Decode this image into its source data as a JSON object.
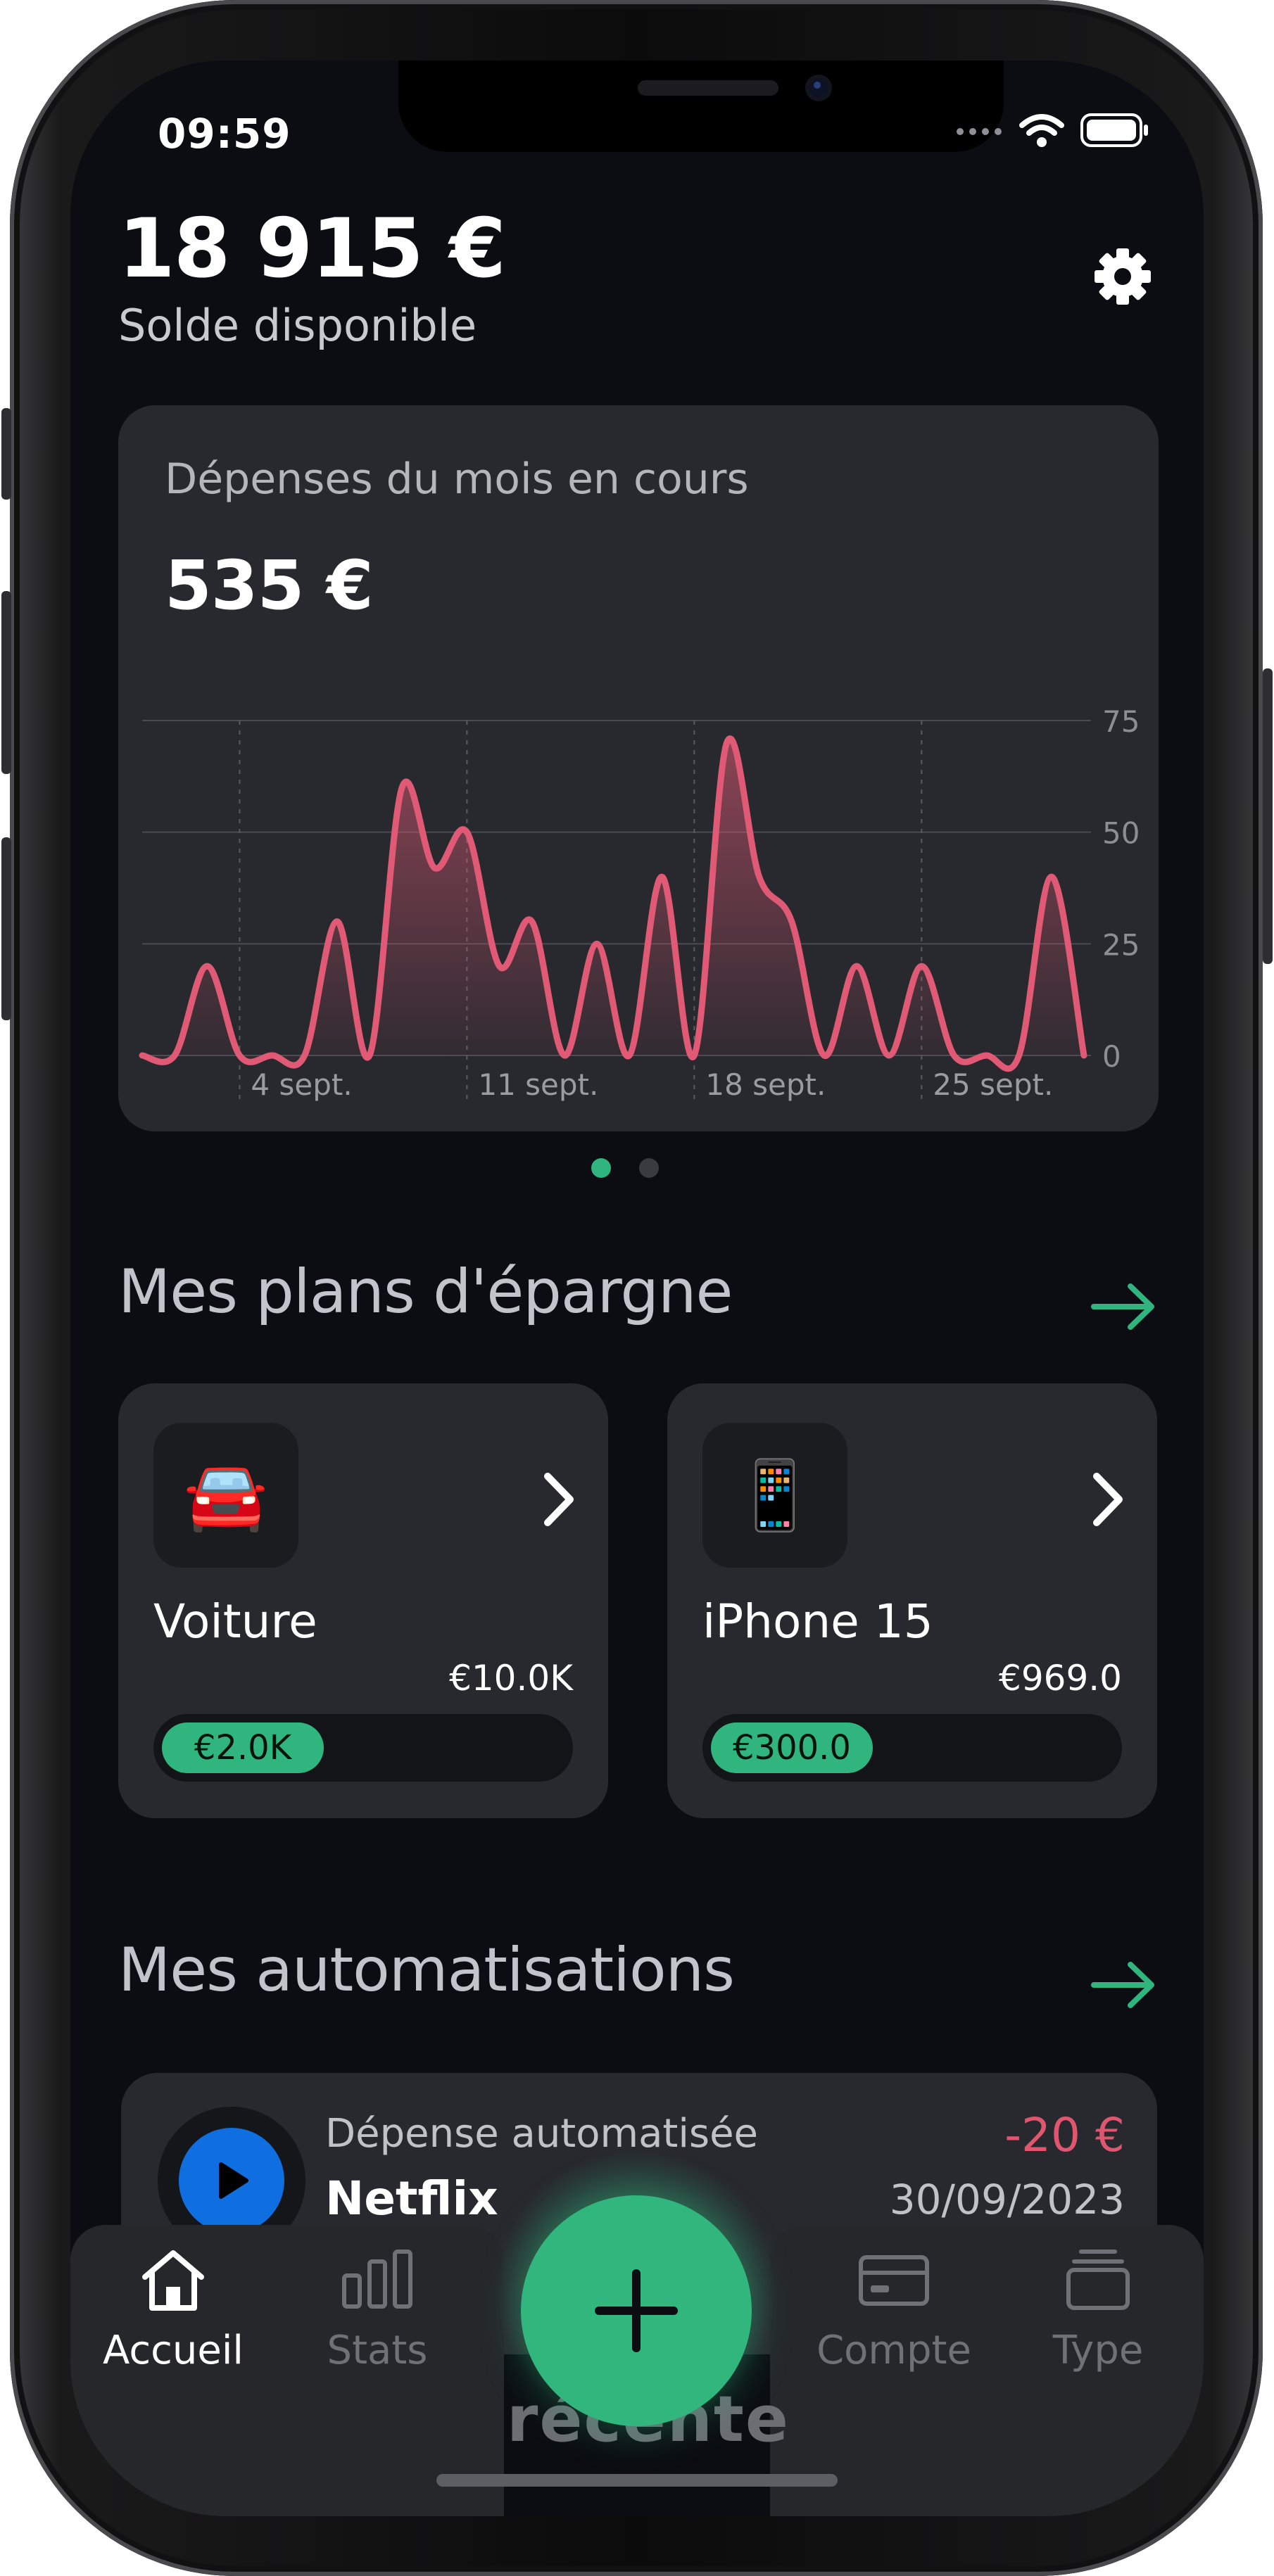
{
  "status_bar": {
    "time": "09:59"
  },
  "header": {
    "balance": "18 915 €",
    "balance_label": "Solde disponible"
  },
  "spending_card": {
    "title": "Dépenses du mois en cours",
    "total": "535 €"
  },
  "chart_data": {
    "type": "area",
    "x": [
      "1 sept.",
      "2 sept.",
      "3 sept.",
      "4 sept.",
      "5 sept.",
      "6 sept.",
      "7 sept.",
      "8 sept.",
      "9 sept.",
      "10 sept.",
      "11 sept.",
      "12 sept.",
      "13 sept.",
      "14 sept.",
      "15 sept.",
      "16 sept.",
      "17 sept.",
      "18 sept.",
      "19 sept.",
      "20 sept.",
      "21 sept.",
      "22 sept.",
      "23 sept.",
      "24 sept.",
      "25 sept.",
      "26 sept.",
      "27 sept.",
      "28 sept.",
      "29 sept.",
      "30 sept."
    ],
    "values": [
      0,
      0,
      20,
      0,
      0,
      0,
      30,
      0,
      60,
      42,
      50,
      20,
      30,
      0,
      25,
      0,
      40,
      0,
      70,
      40,
      30,
      0,
      20,
      0,
      20,
      0,
      0,
      0,
      40,
      0
    ],
    "xticks": [
      "4 sept.",
      "11 sept.",
      "18 sept.",
      "25 sept."
    ],
    "yticks": [
      0,
      25,
      50,
      75
    ],
    "ylim": [
      0,
      75
    ],
    "grid": true,
    "color": "#e05a76"
  },
  "pager": {
    "count": 2,
    "active": 0
  },
  "savings": {
    "title": "Mes plans d'épargne",
    "plans": [
      {
        "emoji": "🚘",
        "name": "Voiture",
        "target": "€10.0K",
        "saved": "€2.0K",
        "progress": 0.2
      },
      {
        "emoji": "📱",
        "name": "iPhone 15",
        "target": "€969.0",
        "saved": "€300.0",
        "progress": 0.31
      }
    ]
  },
  "automations": {
    "title": "Mes automatisations",
    "item": {
      "type": "Dépense automatisée",
      "name": "Netflix",
      "amount": "-20 €",
      "date": "30/09/2023"
    }
  },
  "behind_text": "récente",
  "tabbar": {
    "home": "Accueil",
    "stats": "Stats",
    "account": "Compte",
    "type": "Type"
  },
  "colors": {
    "accent": "#2fb57d",
    "negative": "#e0566e",
    "background": "#0b0d12",
    "card": "#28292e"
  }
}
